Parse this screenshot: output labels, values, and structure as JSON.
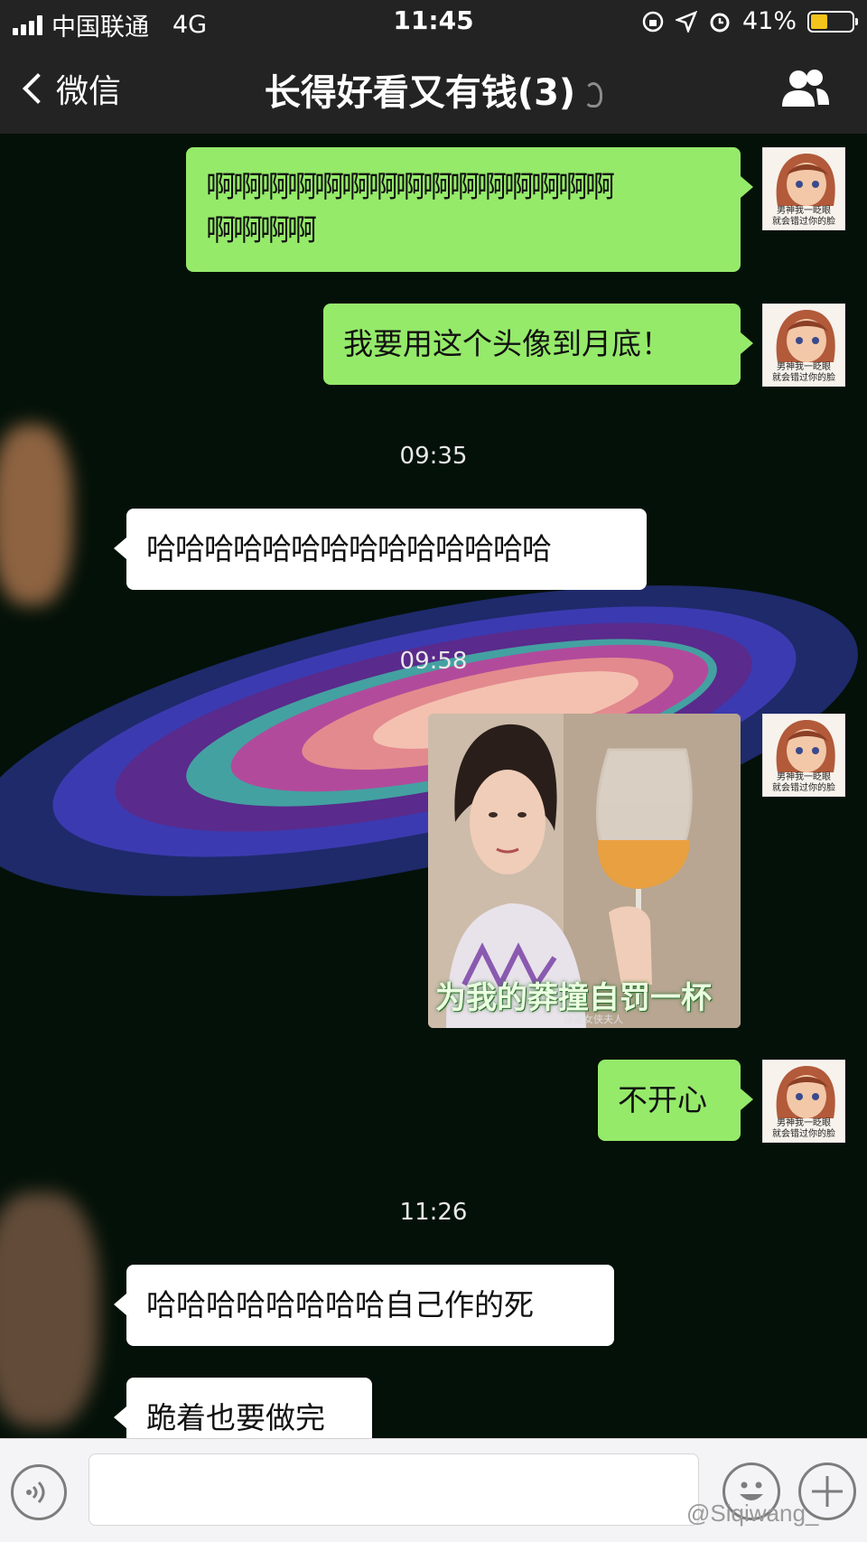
{
  "status_bar": {
    "carrier": "中国联通",
    "network": "4G",
    "time": "11:45",
    "battery": "41%",
    "battery_level": 0.41
  },
  "nav": {
    "back_label": "微信",
    "title": "长得好看又有钱(3)"
  },
  "avatar_caption_1": "男神我一眨眼",
  "avatar_caption_2": "就会错过你的脸",
  "messages": [
    {
      "side": "me",
      "text": "啊啊啊啊啊啊啊啊啊啊啊啊啊啊啊"
    },
    {
      "side": "me",
      "text": "啊啊啊啊"
    },
    {
      "side": "me",
      "text": "我要用这个头像到月底！"
    },
    {
      "type": "time",
      "text": "09:35"
    },
    {
      "side": "other",
      "text": "哈哈哈哈哈哈哈哈哈哈哈哈哈哈"
    },
    {
      "type": "time",
      "text": "09:58"
    },
    {
      "side": "me",
      "type": "sticker",
      "caption": "为我的莽撞自罚一杯",
      "watermark": "@淑女侠夫人"
    },
    {
      "side": "me",
      "text": "不开心"
    },
    {
      "type": "time",
      "text": "11:26"
    },
    {
      "side": "other",
      "text": "哈哈哈哈哈哈哈哈自己作的死"
    },
    {
      "side": "other",
      "text": "跪着也要做完"
    }
  ],
  "watermark": "@Siqiwang_",
  "colors": {
    "bar": "#232323",
    "my_bubble": "#95ea6a",
    "other_bubble": "#ffffff",
    "battery": "#f3c41c"
  }
}
